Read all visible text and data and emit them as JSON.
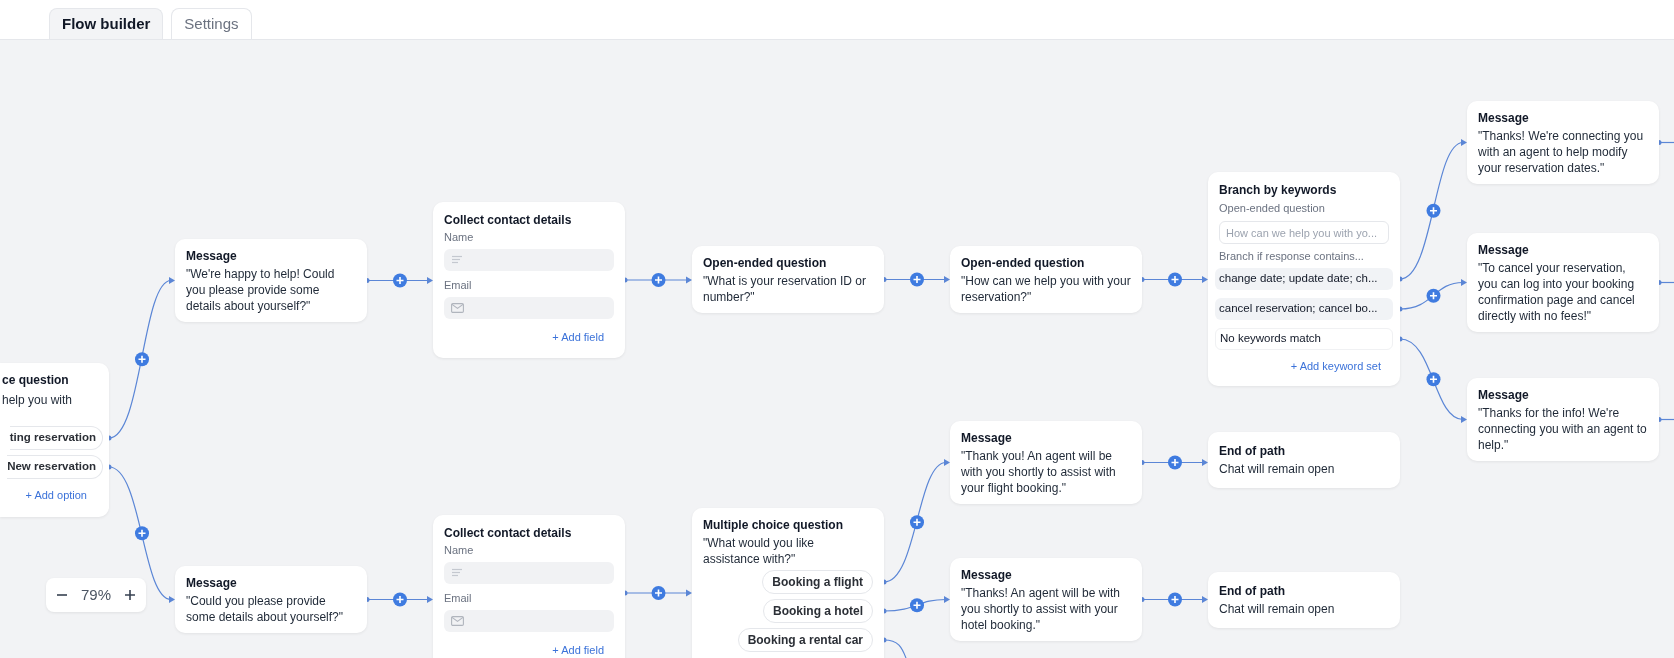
{
  "tabs": [
    {
      "label": "Flow builder",
      "selected": true
    },
    {
      "label": "Settings",
      "selected": false
    }
  ],
  "nodes": [
    {
      "kind": "choice",
      "title": "ce question",
      "text": "help you with",
      "options": [
        "ting reservation",
        "New reservation"
      ],
      "add": "+ Add option"
    },
    {
      "kind": "message",
      "title": "Message",
      "text": "\"We're happy to help! Could you please provide some details about yourself?\""
    },
    {
      "kind": "message",
      "title": "Message",
      "text": "\"Could you please provide some details about yourself?\""
    },
    {
      "kind": "contact",
      "title": "Collect contact details",
      "fields": [
        {
          "label": "Name",
          "kind": "text"
        },
        {
          "label": "Email",
          "kind": "email"
        }
      ],
      "add": "+ Add field"
    },
    {
      "kind": "contact",
      "title": "Collect contact details",
      "fields": [
        {
          "label": "Name",
          "kind": "text"
        },
        {
          "label": "Email",
          "kind": "email"
        }
      ],
      "add": "+ Add field"
    },
    {
      "kind": "question",
      "title": "Open-ended question",
      "text": "\"What is your reservation ID or number?\""
    },
    {
      "kind": "choice",
      "title": "Multiple choice question",
      "text": "\"What would you like assistance with?\"",
      "options": [
        "Booking a flight",
        "Booking a hotel",
        "Booking a rental car"
      ]
    },
    {
      "kind": "question",
      "title": "Open-ended question",
      "text": "\"How can we help you with your reservation?\""
    },
    {
      "kind": "message",
      "title": "Message",
      "text": "\"Thank you! An agent will be with you shortly to assist with your flight booking.\""
    },
    {
      "kind": "message",
      "title": "Message",
      "text": "\"Thanks! An agent will be with you shortly to assist with your hotel booking.\""
    },
    {
      "kind": "branch",
      "title": "Branch by keywords",
      "question_label": "Open-ended question",
      "placeholder": "How can we help you with yo...",
      "rows_label": "Branch if response contains...",
      "rows": [
        {
          "text": "change date; update date; ch...",
          "kind": "keywords"
        },
        {
          "text": "cancel reservation; cancel bo...",
          "kind": "keywords"
        },
        {
          "text": "No keywords match",
          "kind": "fallback"
        }
      ],
      "add": "+ Add keyword set"
    },
    {
      "kind": "end",
      "title": "End of path",
      "text": "Chat will remain open"
    },
    {
      "kind": "end",
      "title": "End of path",
      "text": "Chat will remain open"
    },
    {
      "kind": "message",
      "title": "Message",
      "text": "\"Thanks! We're connecting you with an agent to help modify your reservation dates.\""
    },
    {
      "kind": "message",
      "title": "Message",
      "text": "\"To cancel your reservation, you can log into your booking confirmation page and cancel directly with no fees!\""
    },
    {
      "kind": "message",
      "title": "Message",
      "text": "\"Thanks for the info! We're connecting you with an agent to help.\""
    }
  ],
  "zoom": {
    "value": "79%"
  }
}
